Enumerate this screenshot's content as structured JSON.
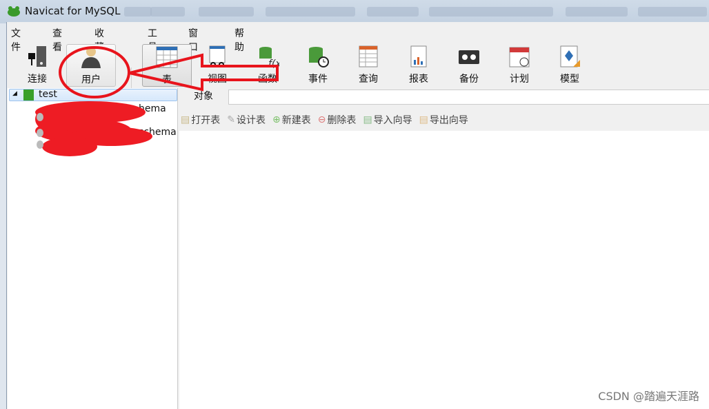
{
  "window": {
    "title": "Navicat for MySQL"
  },
  "menu": [
    "文件",
    "查看",
    "收藏夹",
    "工具",
    "窗口",
    "帮助"
  ],
  "toolbar": [
    {
      "label": "连接",
      "icon": "connection-icon"
    },
    {
      "label": "用户",
      "icon": "user-icon"
    },
    {
      "label": "表",
      "icon": "table-icon"
    },
    {
      "label": "视图",
      "icon": "view-icon"
    },
    {
      "label": "函数",
      "icon": "function-icon"
    },
    {
      "label": "事件",
      "icon": "event-icon"
    },
    {
      "label": "查询",
      "icon": "query-icon"
    },
    {
      "label": "报表",
      "icon": "report-icon"
    },
    {
      "label": "备份",
      "icon": "backup-icon"
    },
    {
      "label": "计划",
      "icon": "schedule-icon"
    },
    {
      "label": "模型",
      "icon": "model-icon"
    }
  ],
  "tree": {
    "root": "test",
    "items": [
      "hema",
      "schema"
    ]
  },
  "tabs": [
    "对象"
  ],
  "object_toolbar": [
    "打开表",
    "设计表",
    "新建表",
    "删除表",
    "导入向导",
    "导出向导"
  ],
  "watermark": "CSDN @踏遍天涯路",
  "colors": {
    "annotation": "#e8141c",
    "accent": "#2f6fb5"
  }
}
